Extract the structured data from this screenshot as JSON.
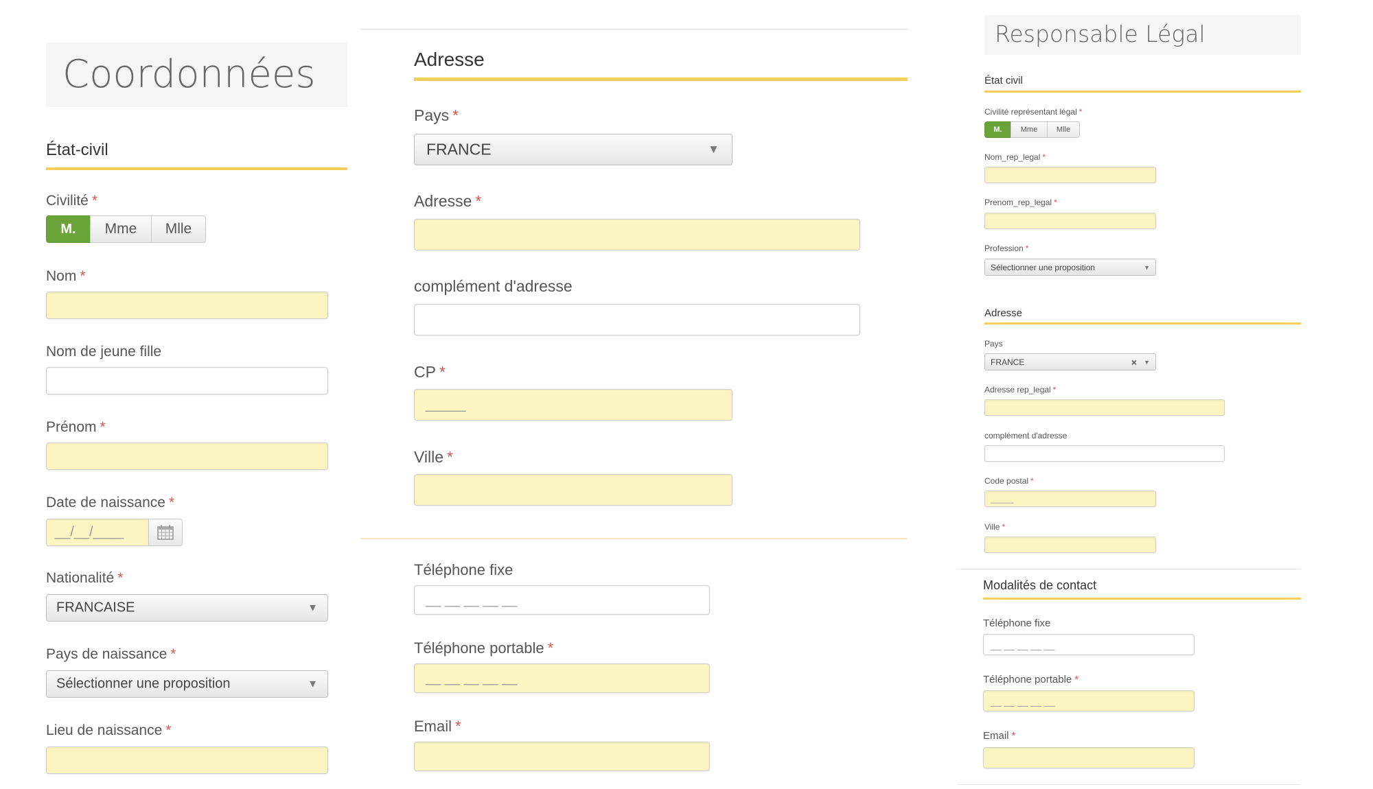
{
  "left": {
    "page_title": "Coordonnées",
    "section_title": "État-civil",
    "civilite": {
      "label": "Civilité",
      "options": [
        "M.",
        "Mme",
        "Mlle"
      ],
      "selected": "M."
    },
    "nom": {
      "label": "Nom",
      "value": ""
    },
    "nom_jeune_fille": {
      "label": "Nom de jeune fille",
      "value": ""
    },
    "prenom": {
      "label": "Prénom",
      "value": ""
    },
    "date_naissance": {
      "label": "Date de naissance",
      "placeholder": "__/__/____"
    },
    "nationalite": {
      "label": "Nationalité",
      "value": "FRANCAISE"
    },
    "pays_naissance": {
      "label": "Pays de naissance",
      "value": "Sélectionner une proposition"
    },
    "lieu_naissance": {
      "label": "Lieu de naissance",
      "value": ""
    }
  },
  "middle": {
    "section_title": "Adresse",
    "pays": {
      "label": "Pays",
      "value": "FRANCE"
    },
    "adresse": {
      "label": "Adresse",
      "value": ""
    },
    "complement": {
      "label": "complément d'adresse",
      "value": ""
    },
    "cp": {
      "label": "CP",
      "placeholder": "_____"
    },
    "ville": {
      "label": "Ville",
      "value": ""
    },
    "tel_fixe": {
      "label": "Téléphone fixe",
      "placeholder": "__ __ __ __ __"
    },
    "tel_portable": {
      "label": "Téléphone portable",
      "placeholder": "__ __ __ __ __"
    },
    "email": {
      "label": "Email",
      "value": ""
    }
  },
  "right": {
    "page_title": "Responsable Légal",
    "etat_civil_title": "État civil",
    "civilite": {
      "label": "Civilité représentant légal",
      "options": [
        "M.",
        "Mme",
        "Mlle"
      ],
      "selected": "M."
    },
    "nom": {
      "label": "Nom_rep_legal",
      "value": ""
    },
    "prenom": {
      "label": "Prenom_rep_legal",
      "value": ""
    },
    "profession": {
      "label": "Profession",
      "value": "Sélectionner une proposition"
    },
    "adresse_title": "Adresse",
    "pays": {
      "label": "Pays",
      "value": "FRANCE",
      "clear": "×"
    },
    "adresse": {
      "label": "Adresse rep_legal",
      "value": ""
    },
    "complement": {
      "label": "complément d'adresse",
      "value": ""
    },
    "code_postal": {
      "label": "Code postal",
      "placeholder": "_____"
    },
    "ville": {
      "label": "Ville",
      "value": ""
    },
    "contact_title": "Modalités de contact",
    "tel_fixe": {
      "label": "Téléphone fixe",
      "placeholder": "__ __ __ __ __"
    },
    "tel_portable": {
      "label": "Téléphone portable",
      "placeholder": "__ __ __ __ __"
    },
    "email": {
      "label": "Email",
      "value": ""
    }
  },
  "common": {
    "required_mark": "*",
    "dropdown_arrow": "▼"
  },
  "colors": {
    "required_fill": "#fcf5c2",
    "accent_underline": "#f5cd5a",
    "selected_green": "#6aa337",
    "required_star": "#d9534f"
  }
}
